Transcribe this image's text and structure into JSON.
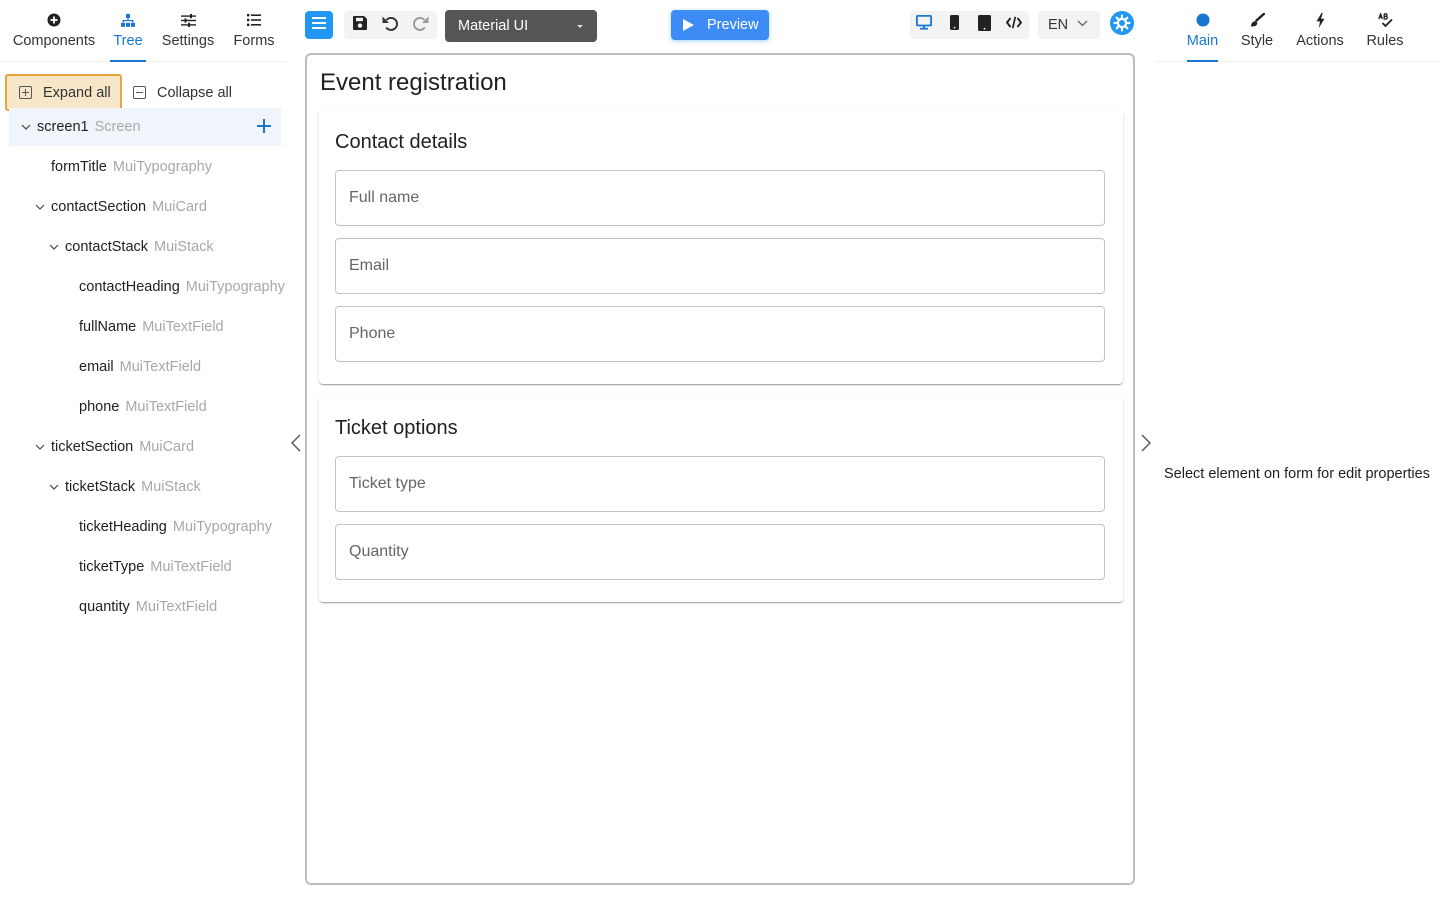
{
  "left_tabs": [
    {
      "label": "Components",
      "icon": "plus-circle-icon"
    },
    {
      "label": "Tree",
      "icon": "tree-icon",
      "active": true
    },
    {
      "label": "Settings",
      "icon": "sliders-icon"
    },
    {
      "label": "Forms",
      "icon": "list-icon"
    }
  ],
  "tree_actions": {
    "expand_all": "Expand all",
    "collapse_all": "Collapse all"
  },
  "tree": [
    {
      "name": "screen1",
      "type": "Screen"
    },
    {
      "name": "formTitle",
      "type": "MuiTypography"
    },
    {
      "name": "contactSection",
      "type": "MuiCard"
    },
    {
      "name": "contactStack",
      "type": "MuiStack"
    },
    {
      "name": "contactHeading",
      "type": "MuiTypography"
    },
    {
      "name": "fullName",
      "type": "MuiTextField"
    },
    {
      "name": "email",
      "type": "MuiTextField"
    },
    {
      "name": "phone",
      "type": "MuiTextField"
    },
    {
      "name": "ticketSection",
      "type": "MuiCard"
    },
    {
      "name": "ticketStack",
      "type": "MuiStack"
    },
    {
      "name": "ticketHeading",
      "type": "MuiTypography"
    },
    {
      "name": "ticketType",
      "type": "MuiTextField"
    },
    {
      "name": "quantity",
      "type": "MuiTextField"
    }
  ],
  "toolbar": {
    "ui_library": "Material UI",
    "preview_label": "Preview",
    "language": "EN"
  },
  "form": {
    "title": "Event registration",
    "contact": {
      "heading": "Contact details",
      "full_name": "Full name",
      "email": "Email",
      "phone": "Phone"
    },
    "ticket": {
      "heading": "Ticket options",
      "ticket_type": "Ticket type",
      "quantity": "Quantity"
    }
  },
  "right_tabs": [
    {
      "label": "Main",
      "icon": "dot-icon",
      "active": true
    },
    {
      "label": "Style",
      "icon": "brush-icon"
    },
    {
      "label": "Actions",
      "icon": "bolt-icon"
    },
    {
      "label": "Rules",
      "icon": "rules-icon"
    }
  ],
  "right_panel": {
    "placeholder": "Select element on form for edit properties"
  },
  "colors": {
    "accent": "#1976d2",
    "primary_button": "#2196f3",
    "highlight_fill": "#f7e6c8",
    "highlight_border": "#e8a33d"
  }
}
